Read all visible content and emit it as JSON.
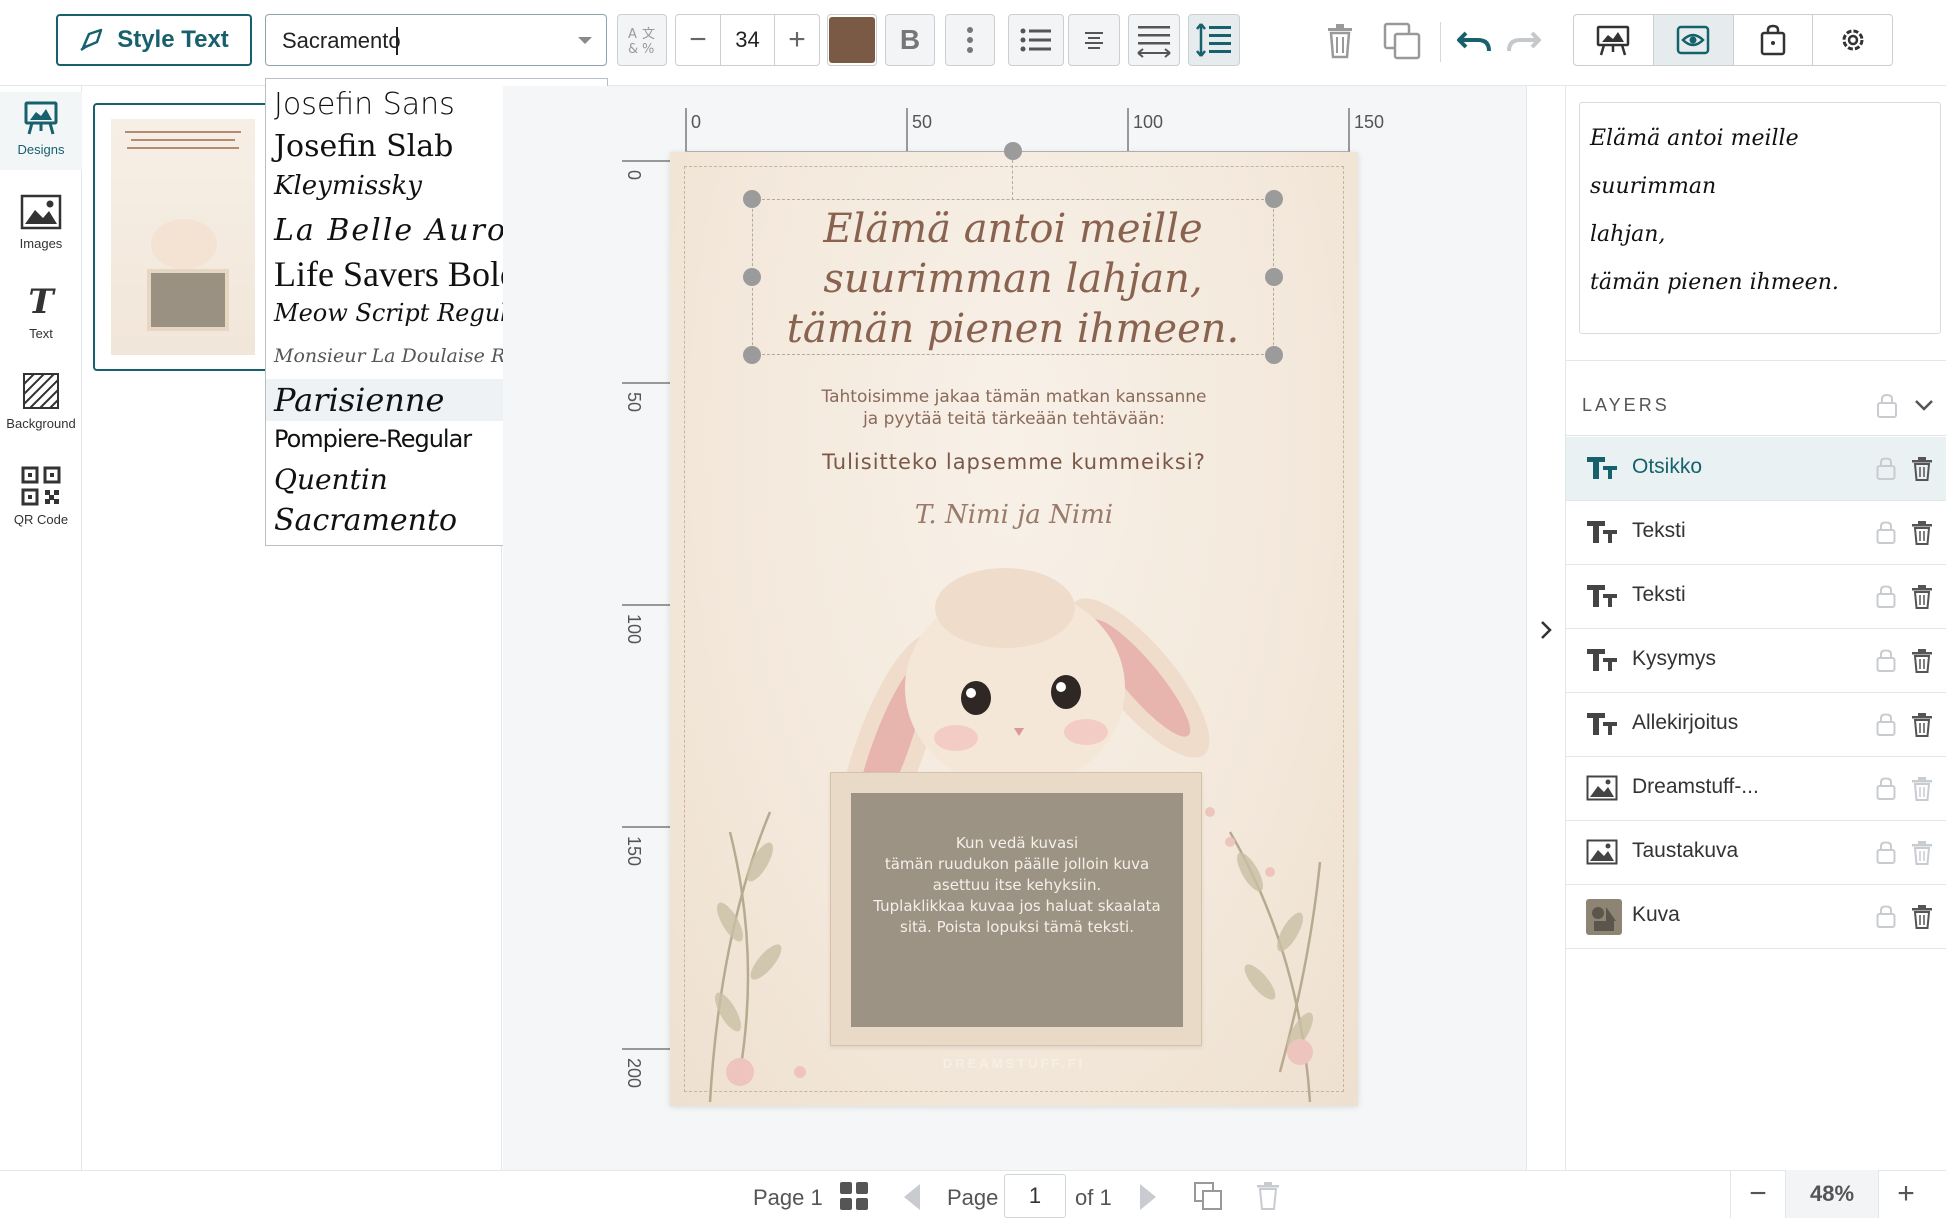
{
  "toolbar": {
    "style_text_label": "Style Text",
    "font_value": "Sacramento",
    "font_size": "34",
    "text_color": "#7b5a45",
    "bold_label": "B"
  },
  "left_rail": [
    {
      "label": "Designs"
    },
    {
      "label": "Images"
    },
    {
      "label": "Text"
    },
    {
      "label": "Background"
    },
    {
      "label": "QR Code"
    }
  ],
  "font_list": [
    "Josefin Sans",
    "Josefin Slab",
    "Kleymissky",
    "La Belle Aurore",
    "Life Savers Bold",
    "Meow Script Regular",
    "Monsieur La Doulaise Regular",
    "Parisienne",
    "Pompiere-Regular",
    "Quentin",
    "Sacramento"
  ],
  "ruler": {
    "h_ticks": [
      "0",
      "50",
      "100",
      "150"
    ],
    "v_ticks": [
      "0",
      "50",
      "100",
      "150",
      "200"
    ]
  },
  "card": {
    "title_lines": [
      "Elämä antoi meille",
      "suurimman lahjan,",
      "tämän pienen ihmeen."
    ],
    "body_lines": [
      "Tahtoisimme jakaa tämän matkan kanssanne",
      "ja pyytää teitä tärkeään tehtävään:"
    ],
    "question": "Tulisitteko lapsemme kummeiksi?",
    "signature": "T. Nimi ja Nimi",
    "frame_lines": [
      "Kun vedä kuvasi",
      "tämän ruudukon päälle jolloin kuva",
      "asettuu itse kehyksiin.",
      "Tuplaklikkaa kuvaa jos haluat skaalata",
      "sitä. Poista lopuksi tämä teksti."
    ],
    "watermark": "DREAMSTUFF.FI"
  },
  "text_editor": {
    "lines": [
      "Elämä antoi meille suurimman",
      "lahjan,",
      "tämän pienen ihmeen."
    ]
  },
  "layers": {
    "heading": "LAYERS",
    "items": [
      {
        "name": "Otsikko",
        "type": "text",
        "active": true
      },
      {
        "name": "Teksti",
        "type": "text"
      },
      {
        "name": "Teksti",
        "type": "text"
      },
      {
        "name": "Kysymys",
        "type": "text"
      },
      {
        "name": "Allekirjoitus",
        "type": "text"
      },
      {
        "name": "Dreamstuff-...",
        "type": "image"
      },
      {
        "name": "Taustakuva",
        "type": "image"
      },
      {
        "name": "Kuva",
        "type": "shape"
      }
    ]
  },
  "footer": {
    "page_label": "Page 1",
    "page_word": "Page",
    "page_value": "1",
    "of_label": "of 1",
    "zoom": "48%"
  }
}
